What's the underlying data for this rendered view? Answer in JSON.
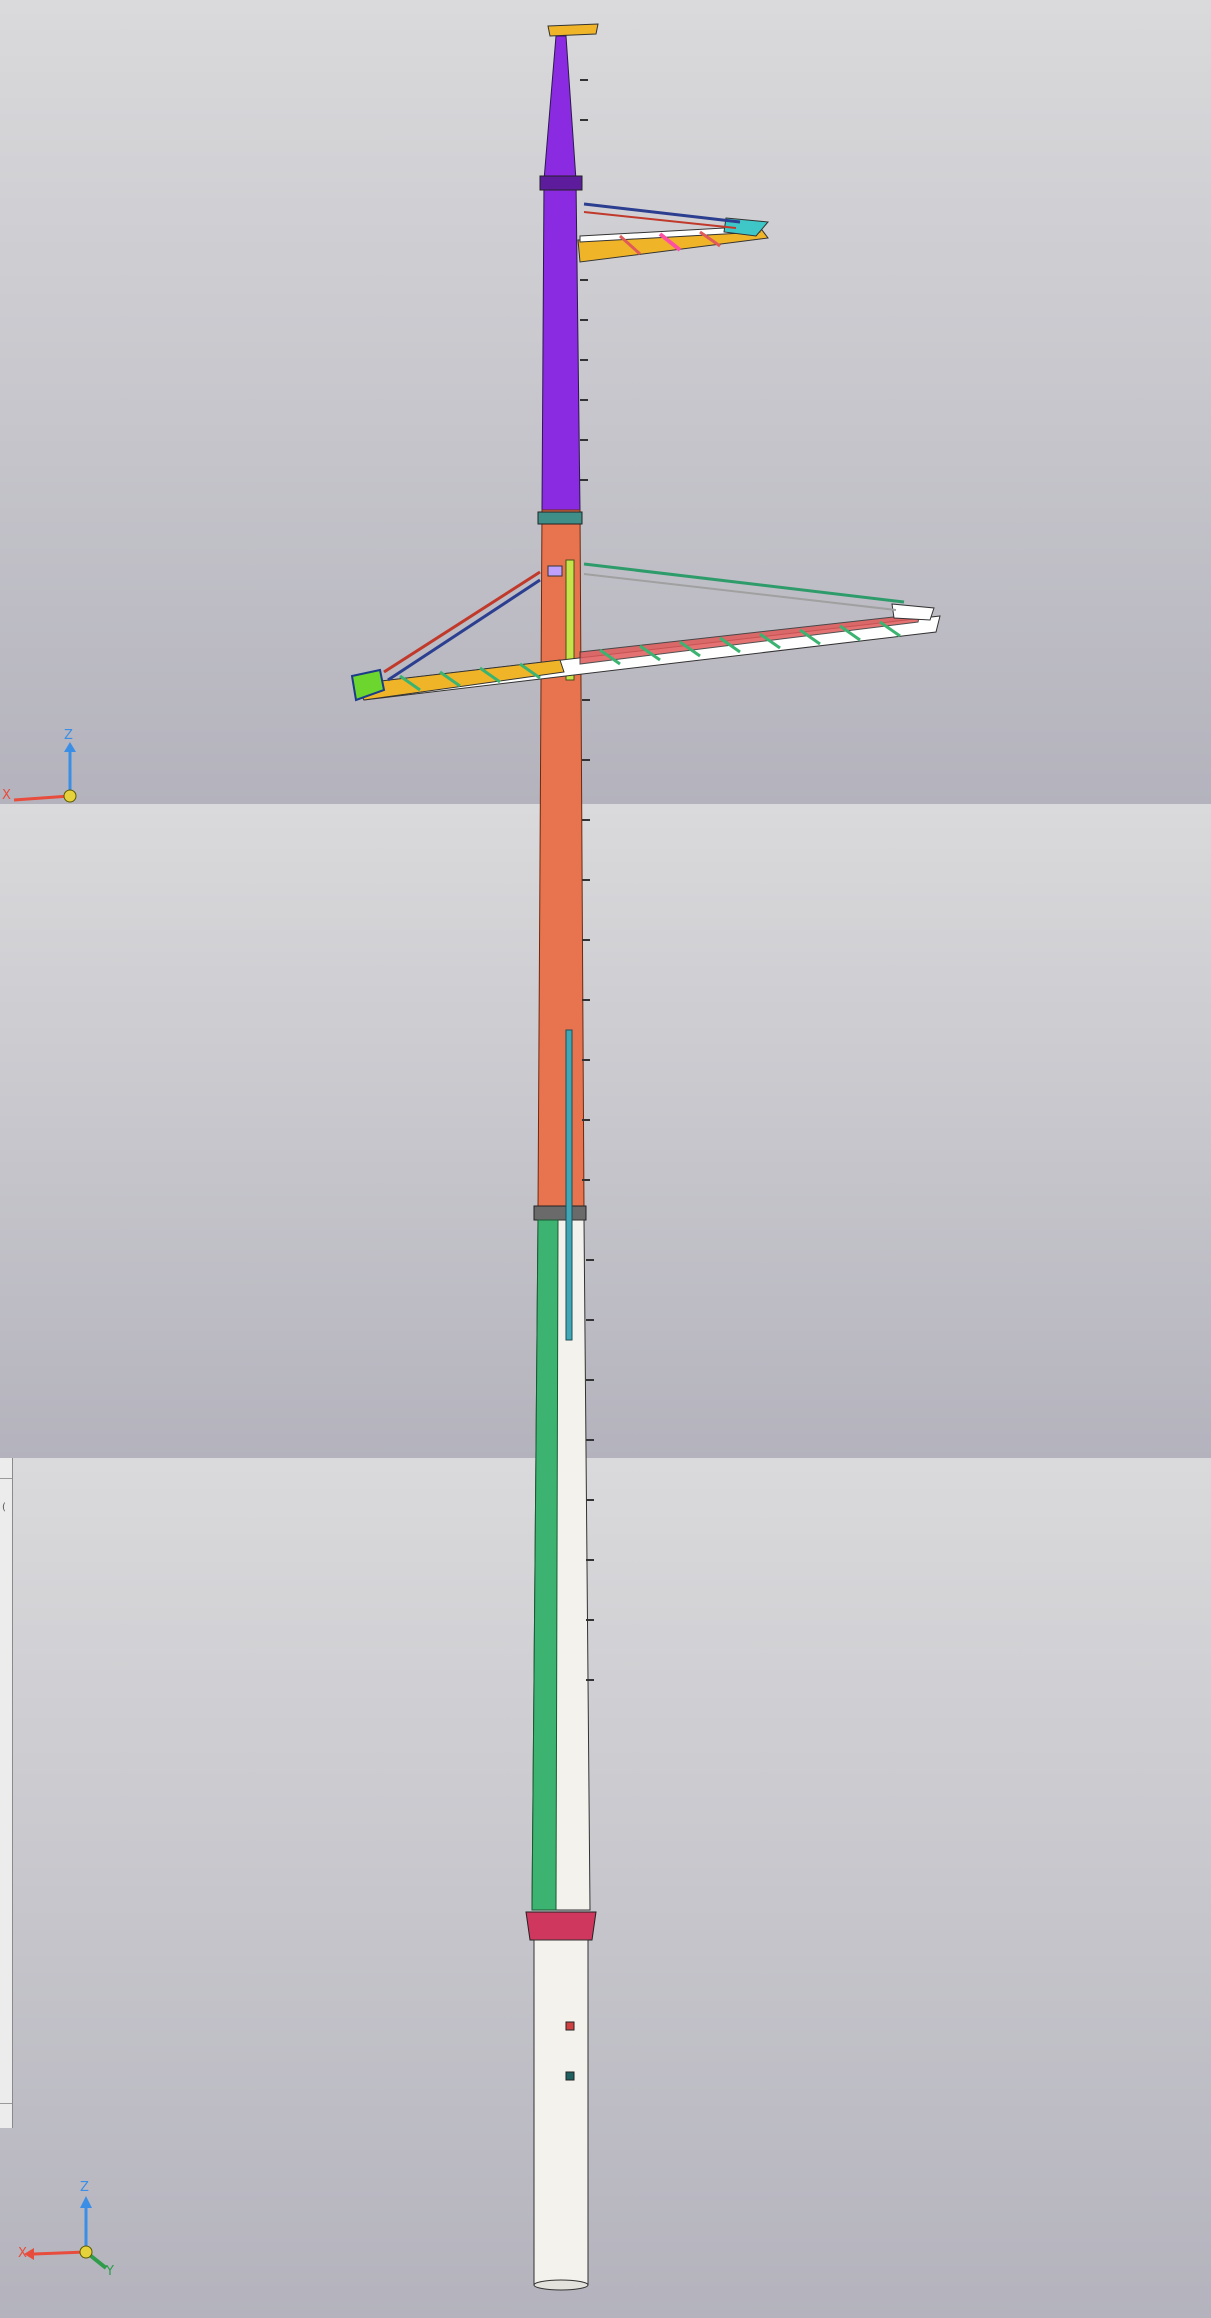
{
  "viewports": [
    {
      "id": "vp1",
      "triad": {
        "z": "Z",
        "x": "X",
        "y": ""
      }
    },
    {
      "id": "vp2"
    },
    {
      "id": "vp3",
      "triad": {
        "z": "Z",
        "x": "X",
        "y": "Y"
      }
    }
  ],
  "side_panel": {
    "text": "("
  },
  "colors": {
    "upper_mast": "#8a2be2",
    "middle_mast": "#e8744f",
    "lower_mast": "#3cb371",
    "base": "#f4f2ec",
    "crossarm_beam": "#f0b429",
    "crossarm_truss": "#e05a5a",
    "tie_red": "#c0392b",
    "tie_blue": "#2c3e90",
    "tie_green": "#2e9c6a",
    "axis_z": "#3a8ee6",
    "axis_x": "#e74c3c",
    "axis_y": "#2e9c4a"
  },
  "icons": [
    "axis-triad-icon"
  ]
}
